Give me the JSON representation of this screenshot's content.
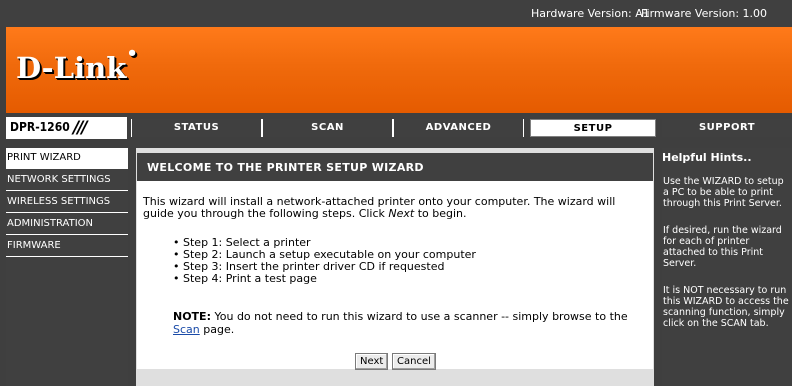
{
  "header": {
    "hardware_version": "Hardware Version: A1",
    "firmware_version": "Firmware Version: 1.00"
  },
  "brand": {
    "logo": "D-Link",
    "accent_color": "#f06a0c"
  },
  "product": {
    "model": "DPR-1260",
    "mark": "///"
  },
  "tabs": [
    {
      "label": "STATUS",
      "active": false
    },
    {
      "label": "SCAN",
      "active": false
    },
    {
      "label": "ADVANCED",
      "active": false
    },
    {
      "label": "SETUP",
      "active": true
    },
    {
      "label": "SUPPORT",
      "active": false
    }
  ],
  "sidebar": {
    "items": [
      {
        "label": "PRINT WIZARD",
        "active": true
      },
      {
        "label": "NETWORK SETTINGS",
        "active": false
      },
      {
        "label": "WIRELESS SETTINGS",
        "active": false
      },
      {
        "label": "ADMINISTRATION",
        "active": false
      },
      {
        "label": "FIRMWARE",
        "active": false
      }
    ]
  },
  "main": {
    "title": "WELCOME TO THE PRINTER SETUP WIZARD",
    "intro_before": "This wizard will install a network-attached printer onto your computer. The wizard will guide you through the following steps. Click ",
    "intro_emph": "Next",
    "intro_after": " to begin.",
    "steps": [
      "Step 1: Select a printer",
      "Step 2: Launch a setup executable on your computer",
      "Step 3: Insert the printer driver CD if requested",
      "Step 4: Print a test page"
    ],
    "note_label": "NOTE:",
    "note_text": " You do not need to run this wizard to use a scanner -- simply browse to the ",
    "note_link": "Scan",
    "note_after": " page.",
    "next_button": "Next",
    "cancel_button": "Cancel"
  },
  "hints": {
    "title": "Helpful Hints..",
    "items": [
      "Use the WIZARD to setup a PC to be able to print through this Print Server.",
      "If desired, run the wizard for each of printer attached to this Print Server.",
      "It is NOT necessary to run this WIZARD to access the scanning function, simply click on the SCAN tab."
    ]
  }
}
